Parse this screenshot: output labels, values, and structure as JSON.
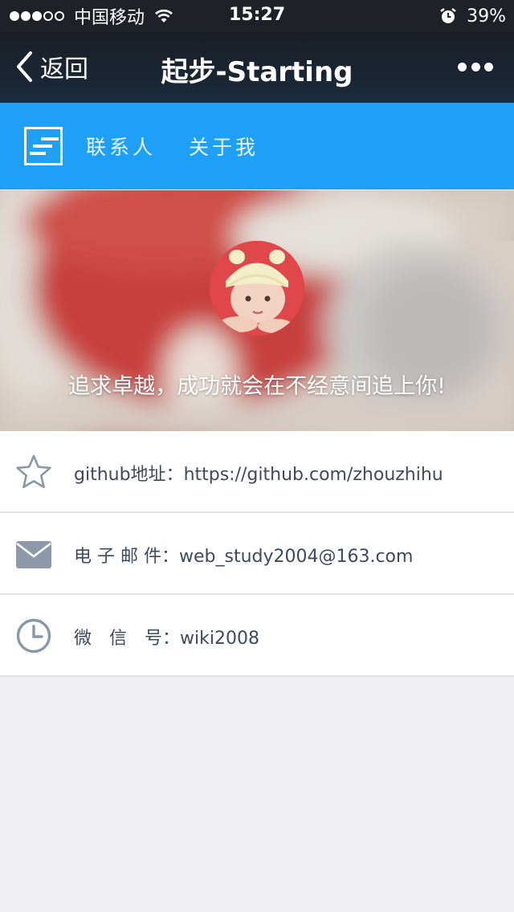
{
  "status_bar": {
    "carrier": "中国移动",
    "signal_strength": 3,
    "time": "15:27",
    "battery": "39%",
    "icons": [
      "signal-dots-icon",
      "wifi-icon",
      "alarm-icon"
    ]
  },
  "nav": {
    "back_label": "返回",
    "title": "起步-Starting",
    "icons": [
      "back-chevron-icon",
      "more-icon"
    ]
  },
  "tabs": {
    "items": [
      {
        "label": "联系人"
      },
      {
        "label": "关于我"
      }
    ],
    "accent_color": "#1fa0f8"
  },
  "banner": {
    "slogan": "追求卓越，成功就会在不经意间追上你!"
  },
  "contact": {
    "items": [
      {
        "icon": "star-icon",
        "label": "github地址：",
        "value": "https://github.com/zhouzhihu"
      },
      {
        "icon": "mail-icon",
        "label": "电 子 邮 件：",
        "value": "web_study2004@163.com"
      },
      {
        "icon": "clock-icon",
        "label": "微　信　号：",
        "value": "wiki2008"
      }
    ]
  }
}
